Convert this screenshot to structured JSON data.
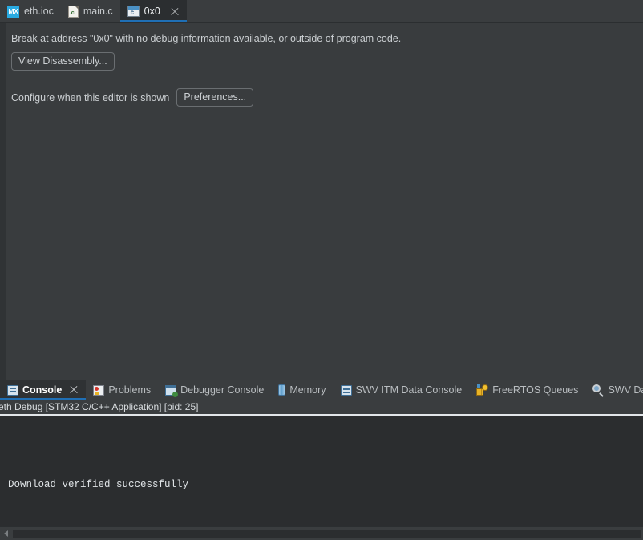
{
  "editor": {
    "tabs": [
      {
        "label": "eth.ioc",
        "icon": "cubemx-icon",
        "icon_text": "MX",
        "active": false,
        "closable": false
      },
      {
        "label": "main.c",
        "icon": "c-source-file-icon",
        "icon_text": ".c",
        "active": false,
        "closable": false
      },
      {
        "label": "0x0",
        "icon": "c-disassembly-window-icon",
        "icon_text": "c",
        "active": true,
        "closable": true
      }
    ],
    "message": "Break at address \"0x0\" with no debug information available, or outside of program code.",
    "view_disassembly_label": "View Disassembly...",
    "configure_text": "Configure when this editor is shown",
    "preferences_label": "Preferences..."
  },
  "bottom": {
    "tabs": [
      {
        "label": "Console",
        "icon": "console-icon",
        "active": true,
        "closable": true
      },
      {
        "label": "Problems",
        "icon": "problems-icon",
        "active": false,
        "closable": false
      },
      {
        "label": "Debugger Console",
        "icon": "debugger-console-icon",
        "active": false,
        "closable": false
      },
      {
        "label": "Memory",
        "icon": "memory-icon",
        "active": false,
        "closable": false
      },
      {
        "label": "SWV ITM Data Console",
        "icon": "swv-itm-data-console-icon",
        "active": false,
        "closable": false
      },
      {
        "label": "FreeRTOS Queues",
        "icon": "freertos-queues-icon",
        "active": false,
        "closable": false
      },
      {
        "label": "SWV Data Trace",
        "icon": "swv-data-trace-icon",
        "active": false,
        "closable": false
      }
    ],
    "console_status": "eth Debug [STM32 C/C++ Application]  [pid: 25]",
    "console_output": "Download verified successfully"
  },
  "colors": {
    "accent_blue": "#1f6fb5",
    "window_bg": "#3a3d3f",
    "editor_bg": "#393c3e",
    "console_bg": "#2b2d2f",
    "text": "#cdd1d4",
    "cubemx_cyan": "#29abe2"
  }
}
